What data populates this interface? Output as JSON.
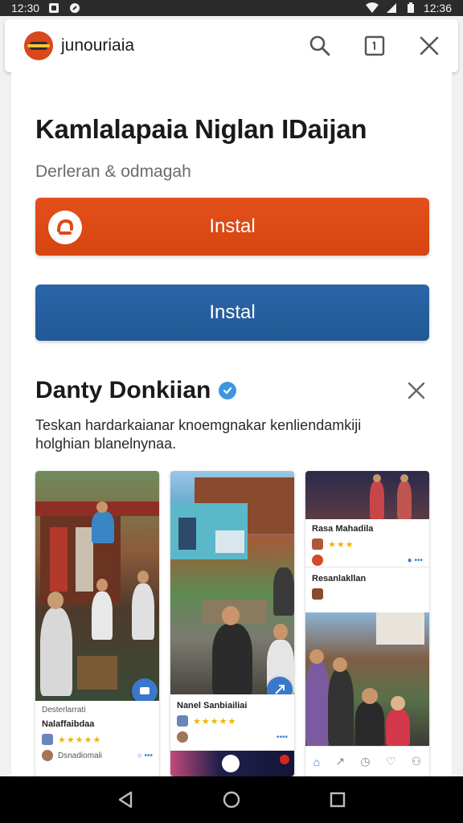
{
  "status_bar": {
    "time_left": "12:30",
    "time_right": "12:36"
  },
  "app_bar": {
    "app_name": "junouriaia"
  },
  "main": {
    "title": "Kamlalapaia Niglan IDaijan",
    "subtitle": "Derleran & odmagah",
    "install_button_primary": "Instal",
    "install_button_secondary": "Instal"
  },
  "developer": {
    "name": "Danty Donkiian",
    "description": "Teskan hardarkaianar knoemgnakar kenliendamkiji holghian blanelnynaa."
  },
  "screenshots": {
    "shot1": {
      "label": "Desterlarrati",
      "title": "Nalaffaibdaa",
      "rating": "★★★★★",
      "footer": "Dsnadiomali"
    },
    "shot2": {
      "title": "Nanel Sanbiailiai",
      "rating": "★★★★★",
      "footer": "••••"
    },
    "shot3": {
      "card1_title": "Rasa Mahadila",
      "card1_rating": "★★★",
      "card2_title": "Resanlakllan"
    }
  }
}
